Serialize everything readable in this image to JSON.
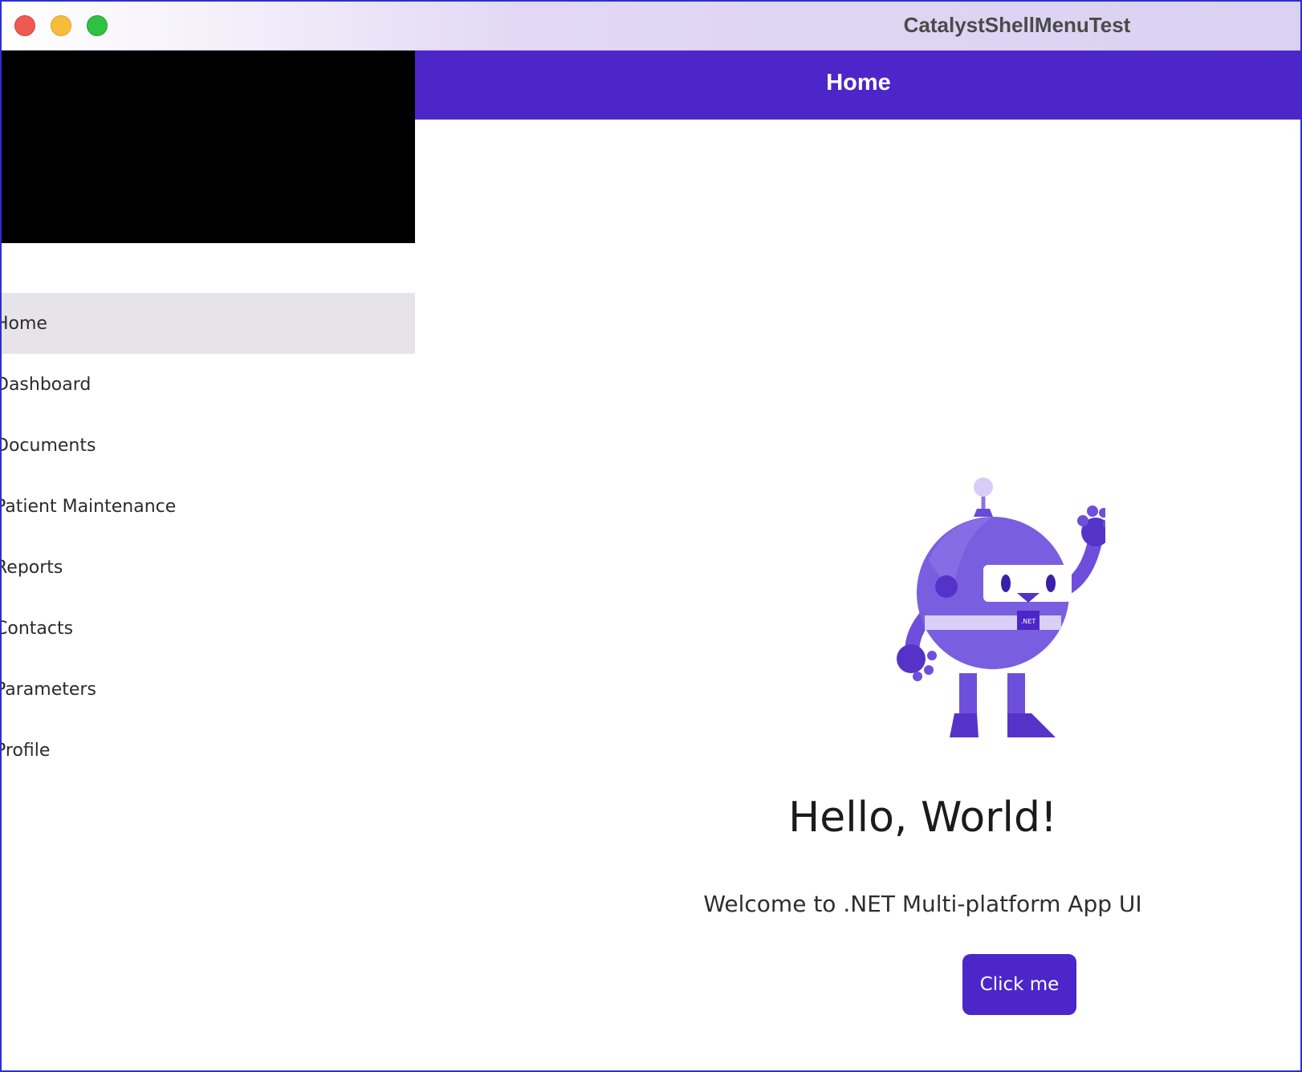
{
  "window": {
    "title": "CatalystShellMenuTest"
  },
  "navbar": {
    "title": "Home"
  },
  "flyout": {
    "items": [
      {
        "label": "Home",
        "selected": true
      },
      {
        "label": "Dashboard",
        "selected": false
      },
      {
        "label": "Documents",
        "selected": false
      },
      {
        "label": "Patient Maintenance",
        "selected": false
      },
      {
        "label": "Reports",
        "selected": false
      },
      {
        "label": "Contacts",
        "selected": false
      },
      {
        "label": "Parameters",
        "selected": false
      },
      {
        "label": "Profile",
        "selected": false
      }
    ]
  },
  "content": {
    "image_icon": "dotnet-bot-icon",
    "heading": "Hello, World!",
    "subheading": "Welcome to .NET Multi-platform App UI",
    "button_label": "Click me"
  },
  "colors": {
    "accent": "#4d26c9",
    "selected_item_bg": "#e6e4e9",
    "flyout_header": "#000000"
  }
}
